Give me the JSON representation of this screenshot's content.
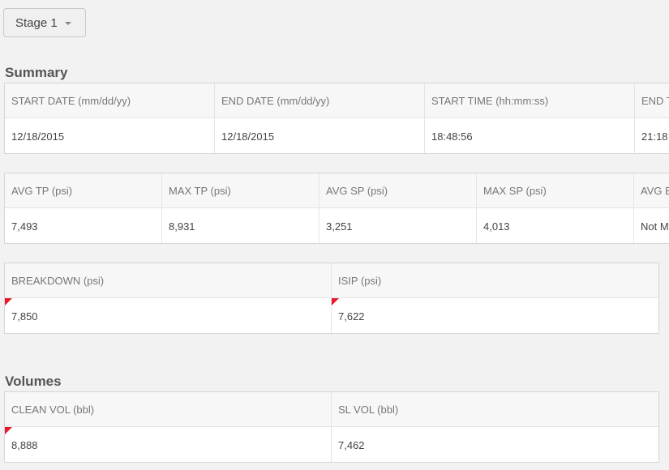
{
  "stage_selector": {
    "label": "Stage 1"
  },
  "summary": {
    "title": "Summary",
    "dates": {
      "headers": [
        "START DATE (mm/dd/yy)",
        "END DATE (mm/dd/yy)",
        "START TIME (hh:mm:ss)",
        "END T"
      ],
      "values": [
        "12/18/2015",
        "12/18/2015",
        "18:48:56",
        "21:18"
      ]
    },
    "pressures": {
      "headers": [
        "AVG TP (psi)",
        "MAX TP (psi)",
        "AVG SP (psi)",
        "MAX SP (psi)",
        "AVG B"
      ],
      "values": [
        "7,493",
        "8,931",
        "3,251",
        "4,013",
        "Not M"
      ]
    },
    "breakdown": {
      "headers": [
        "BREAKDOWN (psi)",
        "ISIP (psi)"
      ],
      "values": [
        "7,850",
        "7,622"
      ]
    }
  },
  "volumes": {
    "title": "Volumes",
    "headers": [
      "CLEAN VOL (bbl)",
      "SL VOL (bbl)"
    ],
    "values": [
      "8,888",
      "7,462"
    ]
  },
  "colors": {
    "flag": "#e8192c",
    "background": "#f2f2f2"
  },
  "icons": {
    "dropdown": "caret-down-icon",
    "edited_marker": "red-corner-flag-icon"
  }
}
